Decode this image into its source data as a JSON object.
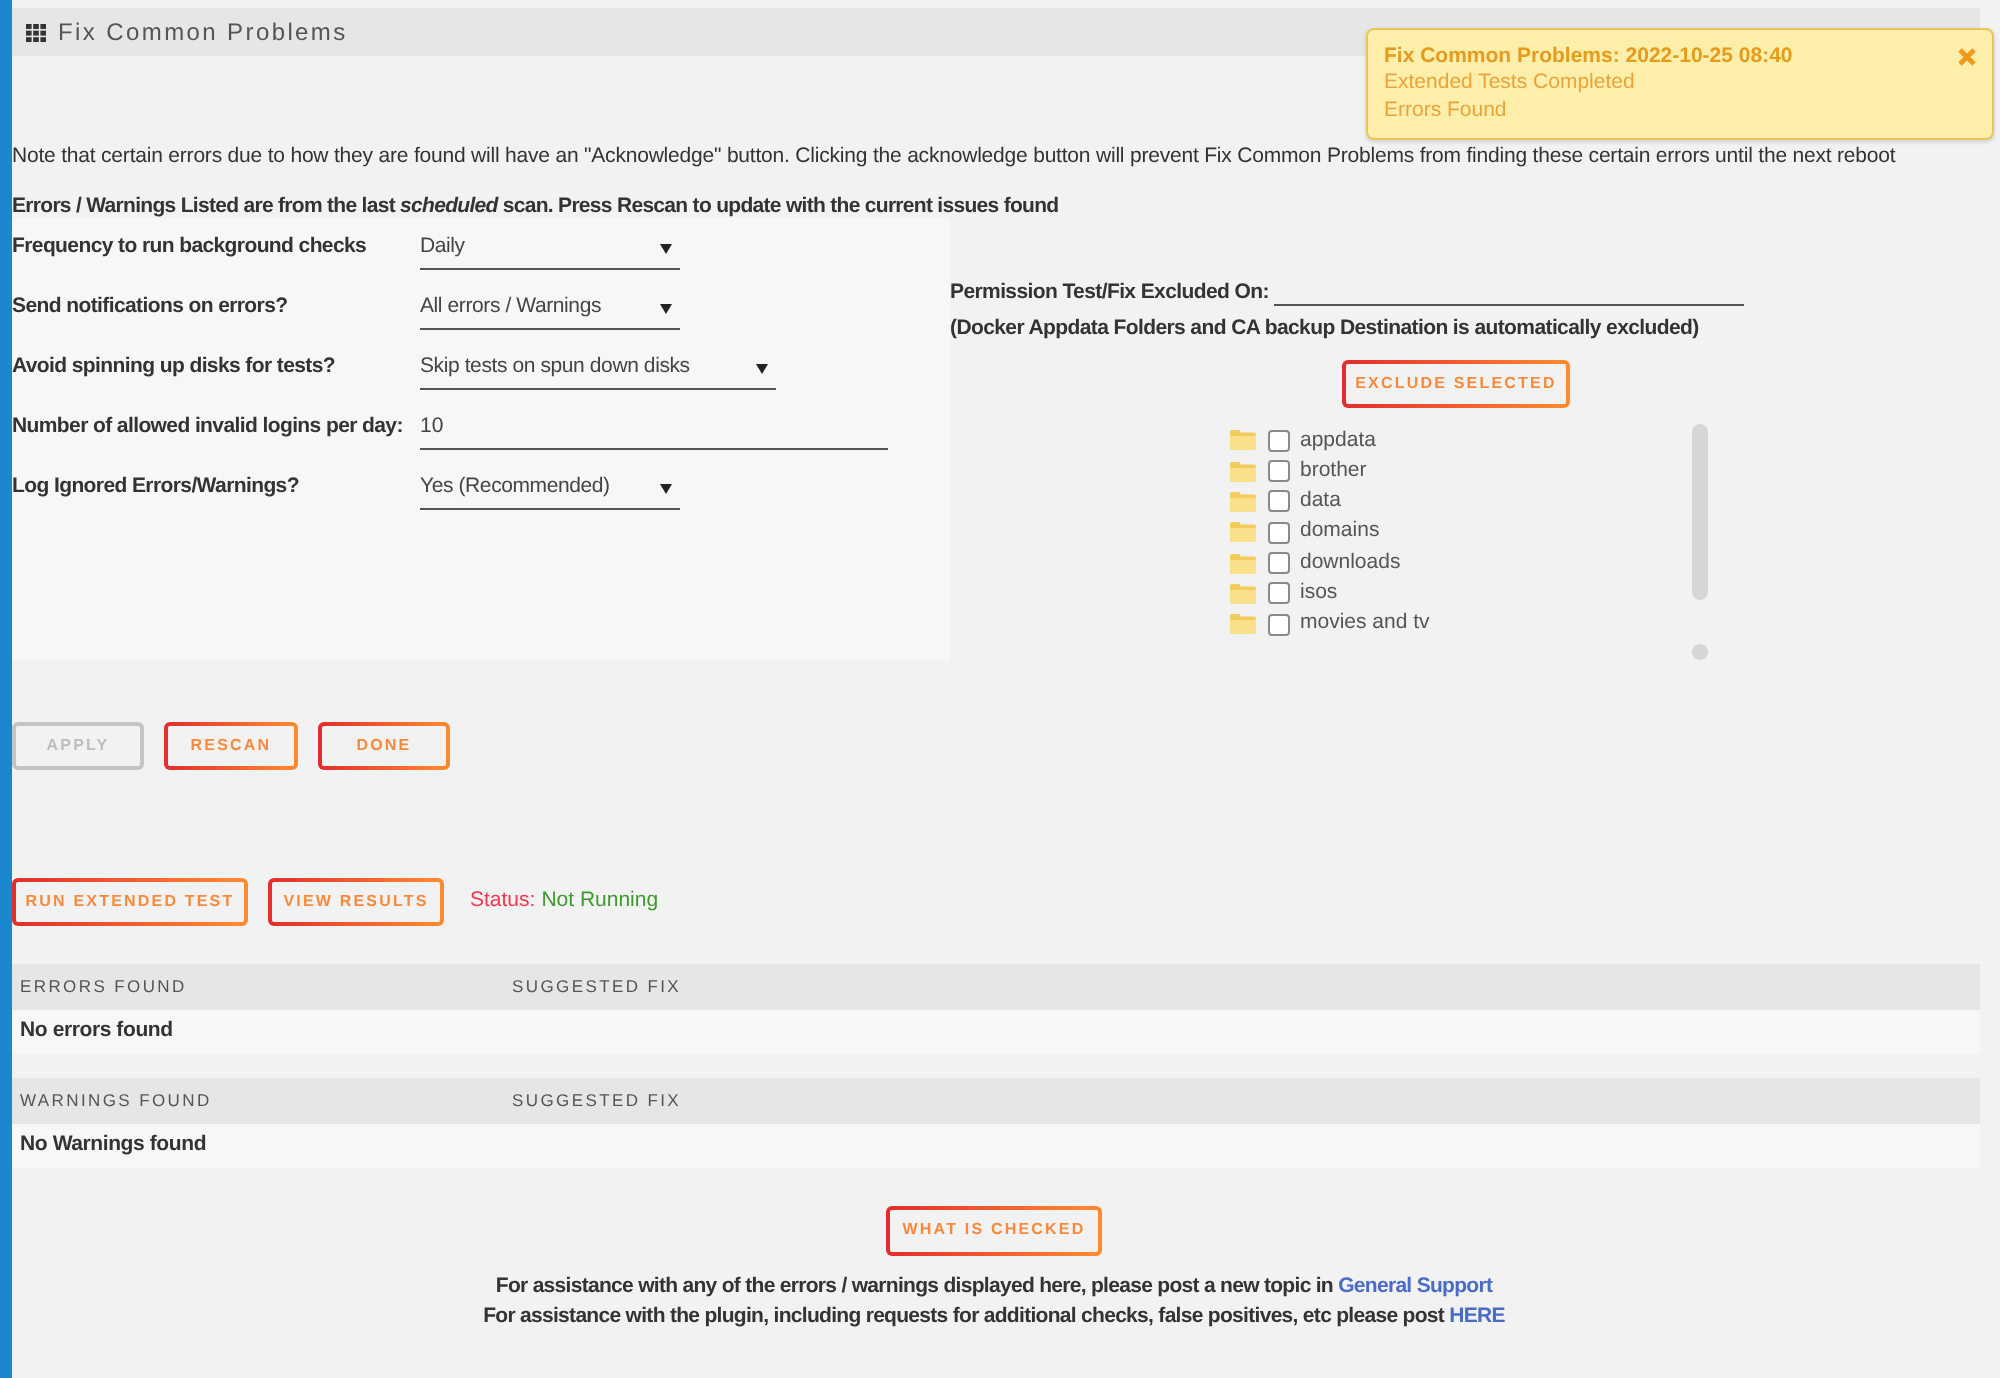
{
  "header": {
    "title": "Fix Common Problems"
  },
  "notification": {
    "title": "Fix Common Problems: 2022-10-25 08:40",
    "lines": [
      "Extended Tests Completed",
      "Errors Found"
    ]
  },
  "notes": [
    {
      "kind": "plain",
      "text": "Note that certain errors due to how they are found will have an \"Acknowledge\" button. Clicking the acknowledge button will prevent Fix Common Problems from finding these certain errors until the next reboot"
    },
    {
      "kind": "bold",
      "text": "Errors / Warnings Listed are from the last *scheduled* scan. Press Rescan to update with the current issues found"
    }
  ],
  "settings": [
    {
      "kind": "select",
      "label": "Frequency to run background checks",
      "value": "Daily"
    },
    {
      "kind": "select",
      "label": "Send notifications on errors?",
      "value": "All errors / Warnings"
    },
    {
      "kind": "select-wide",
      "label": "Avoid spinning up disks for tests?",
      "value": "Skip tests on spun down disks"
    },
    {
      "kind": "input",
      "label": "Number of allowed invalid logins per day:",
      "value": "10"
    },
    {
      "kind": "select",
      "label": "Log Ignored Errors/Warnings?",
      "value": "Yes (Recommended)"
    }
  ],
  "exclusions": {
    "label": "Permission Test/Fix Excluded On:",
    "note": "(Docker Appdata Folders and CA backup Destination is automatically excluded)",
    "button": "EXCLUDE SELECTED",
    "folders": [
      {
        "name": "appdata",
        "checked": false
      },
      {
        "name": "brother",
        "checked": false
      },
      {
        "name": "data",
        "checked": false
      },
      {
        "name": "domains",
        "checked": false
      },
      {
        "name": "downloads",
        "checked": false
      },
      {
        "name": "isos",
        "checked": false
      },
      {
        "name": "movies and tv",
        "checked": false
      }
    ]
  },
  "actions": [
    {
      "label": "APPLY",
      "disabled": true
    },
    {
      "label": "RESCAN",
      "disabled": false
    },
    {
      "label": "DONE",
      "disabled": false
    }
  ],
  "extended": {
    "buttons": [
      {
        "label": "RUN EXTENDED TEST",
        "disabled": false
      },
      {
        "label": "VIEW RESULTS",
        "disabled": false
      }
    ],
    "status_label": "Status:",
    "status_value": "Not Running"
  },
  "tables": [
    {
      "columns": [
        "ERRORS FOUND",
        "SUGGESTED FIX"
      ],
      "empty_message": "No errors found"
    },
    {
      "columns": [
        "WARNINGS FOUND",
        "SUGGESTED FIX"
      ],
      "empty_message": "No Warnings found"
    }
  ],
  "footer": {
    "button": "WHAT IS CHECKED",
    "lines": [
      {
        "text": "For assistance with any of the errors / warnings displayed here, please post a new topic in",
        "link": "General Support"
      },
      {
        "text": "For assistance with the plugin, including requests for additional checks, false positives, etc please post",
        "link": "HERE"
      }
    ]
  }
}
